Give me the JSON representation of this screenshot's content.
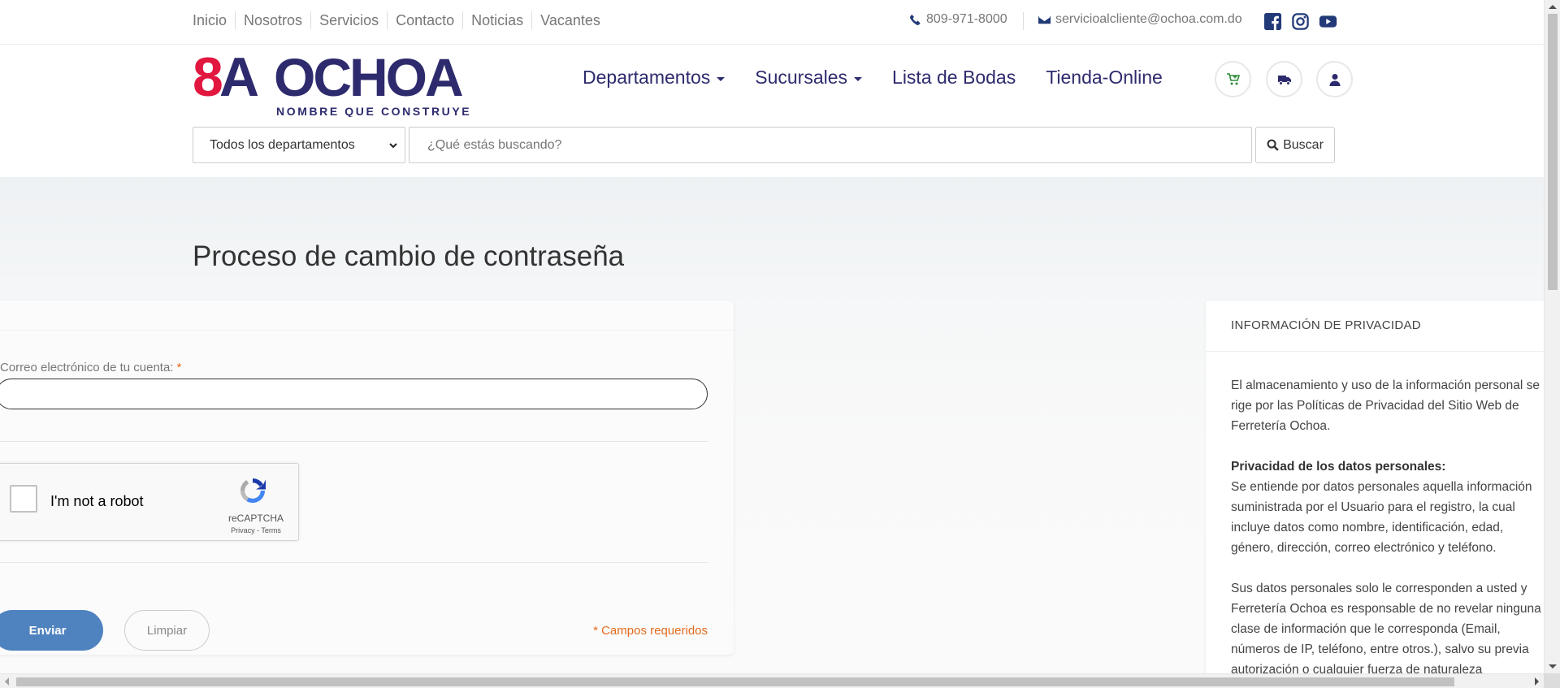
{
  "topbar": {
    "links": [
      "Inicio",
      "Nosotros",
      "Servicios",
      "Contacto",
      "Noticias",
      "Vacantes"
    ],
    "phone": "809-971-8000",
    "email": "servicioalcliente@ochoa.com.do"
  },
  "brand": {
    "logo_text": "8A OCHOA",
    "tagline": "NOMBRE QUE CONSTRUYE",
    "primary_color": "#2d2b6d",
    "accent_color": "#e1173f"
  },
  "nav": {
    "departamentos": "Departamentos",
    "sucursales": "Sucursales",
    "lista_bodas": "Lista de Bodas",
    "tienda": "Tienda-Online"
  },
  "search": {
    "department": "Todos los departamentos",
    "placeholder": "¿Qué estás buscando?",
    "button": "Buscar"
  },
  "page": {
    "title": "Proceso de cambio de contraseña"
  },
  "form": {
    "email_label": "Correo electrónico de tu cuenta:",
    "required_mark": "*",
    "email_value": "",
    "captcha_text": "I'm not a robot",
    "captcha_brand": "reCAPTCHA",
    "captcha_legal": "Privacy - Terms",
    "submit": "Enviar",
    "reset": "Limpiar",
    "required_note": "* Campos requeridos",
    "button_color": "#4f83bf",
    "note_color": "#e36b1c"
  },
  "privacy": {
    "heading": "INFORMACIÓN DE PRIVACIDAD",
    "p1": "El almacenamiento y uso de la información personal se rige por las Políticas de Privacidad del Sitio Web de Ferretería Ochoa.",
    "p2_title": "Privacidad de los datos personales:",
    "p2": "Se entiende por datos personales aquella información suministrada por el Usuario para el registro, la cual incluye datos como nombre, identificación, edad, género, dirección, correo electrónico y teléfono.",
    "p3": "Sus datos personales solo le corresponden a usted y Ferretería Ochoa es responsable de no revelar ninguna clase de información que le corresponda (Email, números de IP, teléfono, entre otros.), salvo su previa autorización o cualquier fuerza de naturaleza"
  },
  "icons": {
    "phone": "phone-icon",
    "email": "envelope-icon",
    "facebook": "facebook-icon",
    "instagram": "instagram-icon",
    "youtube": "youtube-icon",
    "cart": "cart-icon",
    "truck": "truck-icon",
    "user": "user-icon",
    "search": "search-icon",
    "recaptcha": "recaptcha-icon"
  }
}
